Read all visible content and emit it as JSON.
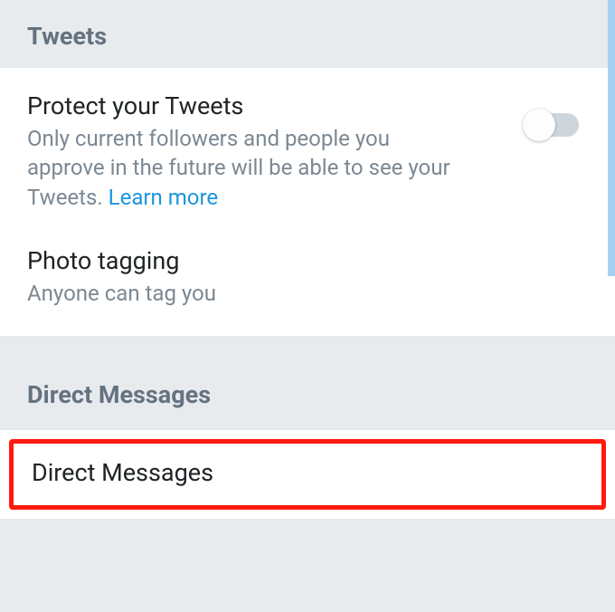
{
  "sections": {
    "tweets": {
      "header": "Tweets",
      "protect": {
        "title": "Protect your Tweets",
        "description_prefix": "Only current followers and people you approve in the future will be able to see your Tweets. ",
        "learn_more": "Learn more",
        "toggle_on": false
      },
      "photo_tagging": {
        "title": "Photo tagging",
        "description": "Anyone can tag you"
      }
    },
    "direct_messages": {
      "header": "Direct Messages",
      "row": {
        "title": "Direct Messages"
      }
    }
  }
}
